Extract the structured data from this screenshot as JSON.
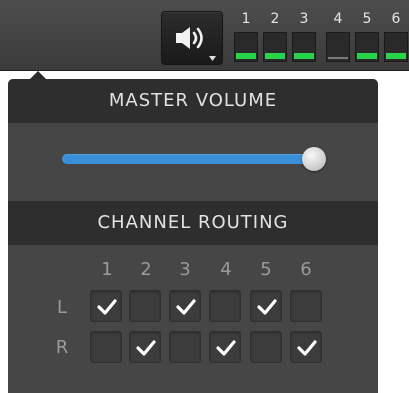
{
  "toolbar": {
    "volume_button": {
      "icon": "speaker-volume-icon",
      "dropdown_icon": "caret-down-icon"
    },
    "meters": [
      {
        "label": "1",
        "active": true
      },
      {
        "label": "2",
        "active": true
      },
      {
        "label": "3",
        "active": true
      },
      {
        "label": "4",
        "active": false
      },
      {
        "label": "5",
        "active": true
      },
      {
        "label": "6",
        "active": true
      }
    ],
    "meter_on_color": "#27d44a"
  },
  "panel": {
    "master_volume": {
      "title": "MASTER VOLUME",
      "level": 1.0,
      "accent_color": "#3a8fd9"
    },
    "channel_routing": {
      "title": "CHANNEL ROUTING",
      "columns": [
        "1",
        "2",
        "3",
        "4",
        "5",
        "6"
      ],
      "rows": [
        {
          "label": "L",
          "checked": [
            true,
            false,
            true,
            false,
            true,
            false
          ]
        },
        {
          "label": "R",
          "checked": [
            false,
            true,
            false,
            true,
            false,
            true
          ]
        }
      ]
    }
  }
}
